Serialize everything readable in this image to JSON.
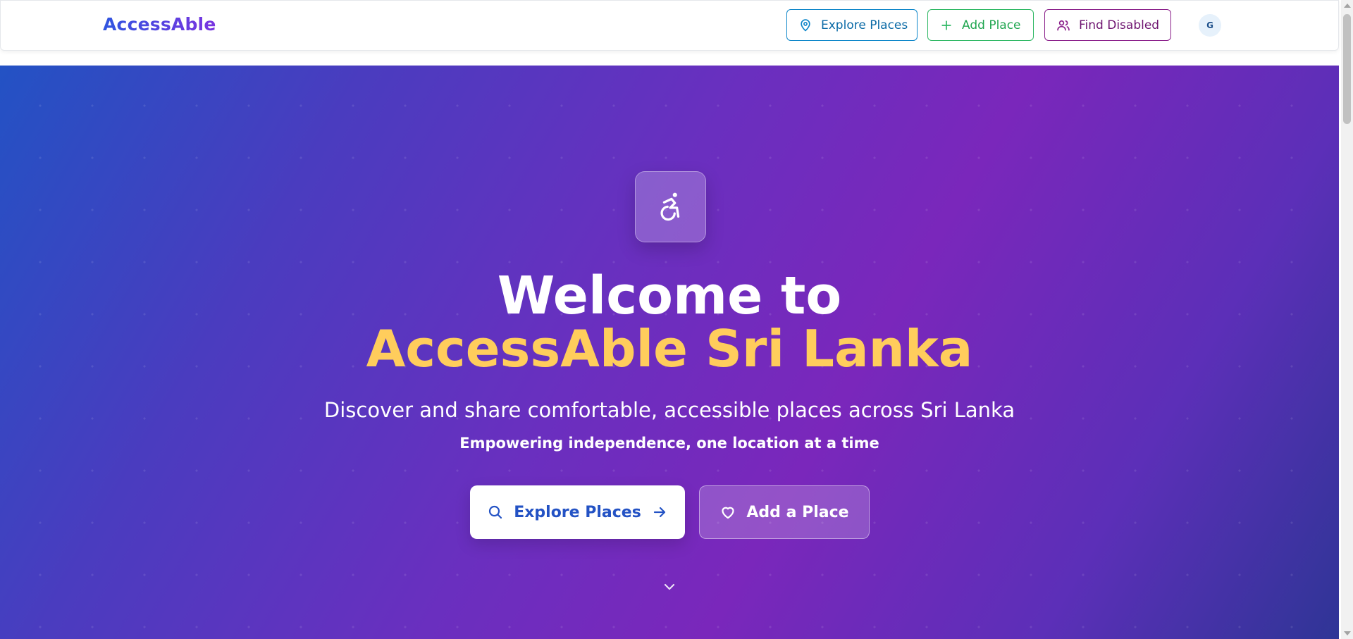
{
  "navbar": {
    "brand": "AccessAble",
    "explore_label": "Explore Places",
    "add_label": "Add Place",
    "find_label": "Find Disabled",
    "avatar_initial": "G",
    "icons": {
      "explore": "map-pin-icon",
      "add": "plus-icon",
      "find": "users-icon"
    },
    "colors": {
      "explore": "#0e86c9",
      "add": "#2fb864",
      "find": "#8a1f8a"
    }
  },
  "hero": {
    "icon": "wheelchair-icon",
    "title_line1": "Welcome to",
    "title_line2": "AccessAble Sri Lanka",
    "subtitle": "Discover and share comfortable, accessible places across Sri Lanka",
    "tagline": "Empowering independence, one location at a time",
    "primary_cta": "Explore Places",
    "secondary_cta": "Add a Place",
    "cta_icons": {
      "primary_left": "search-icon",
      "primary_right": "arrow-right-icon",
      "secondary": "heart-icon"
    },
    "scroll_icon": "chevron-down-icon",
    "accent_color": "#ffcd5c",
    "gradient": [
      "#2352c4",
      "#7a27bb",
      "#2f3596"
    ]
  }
}
